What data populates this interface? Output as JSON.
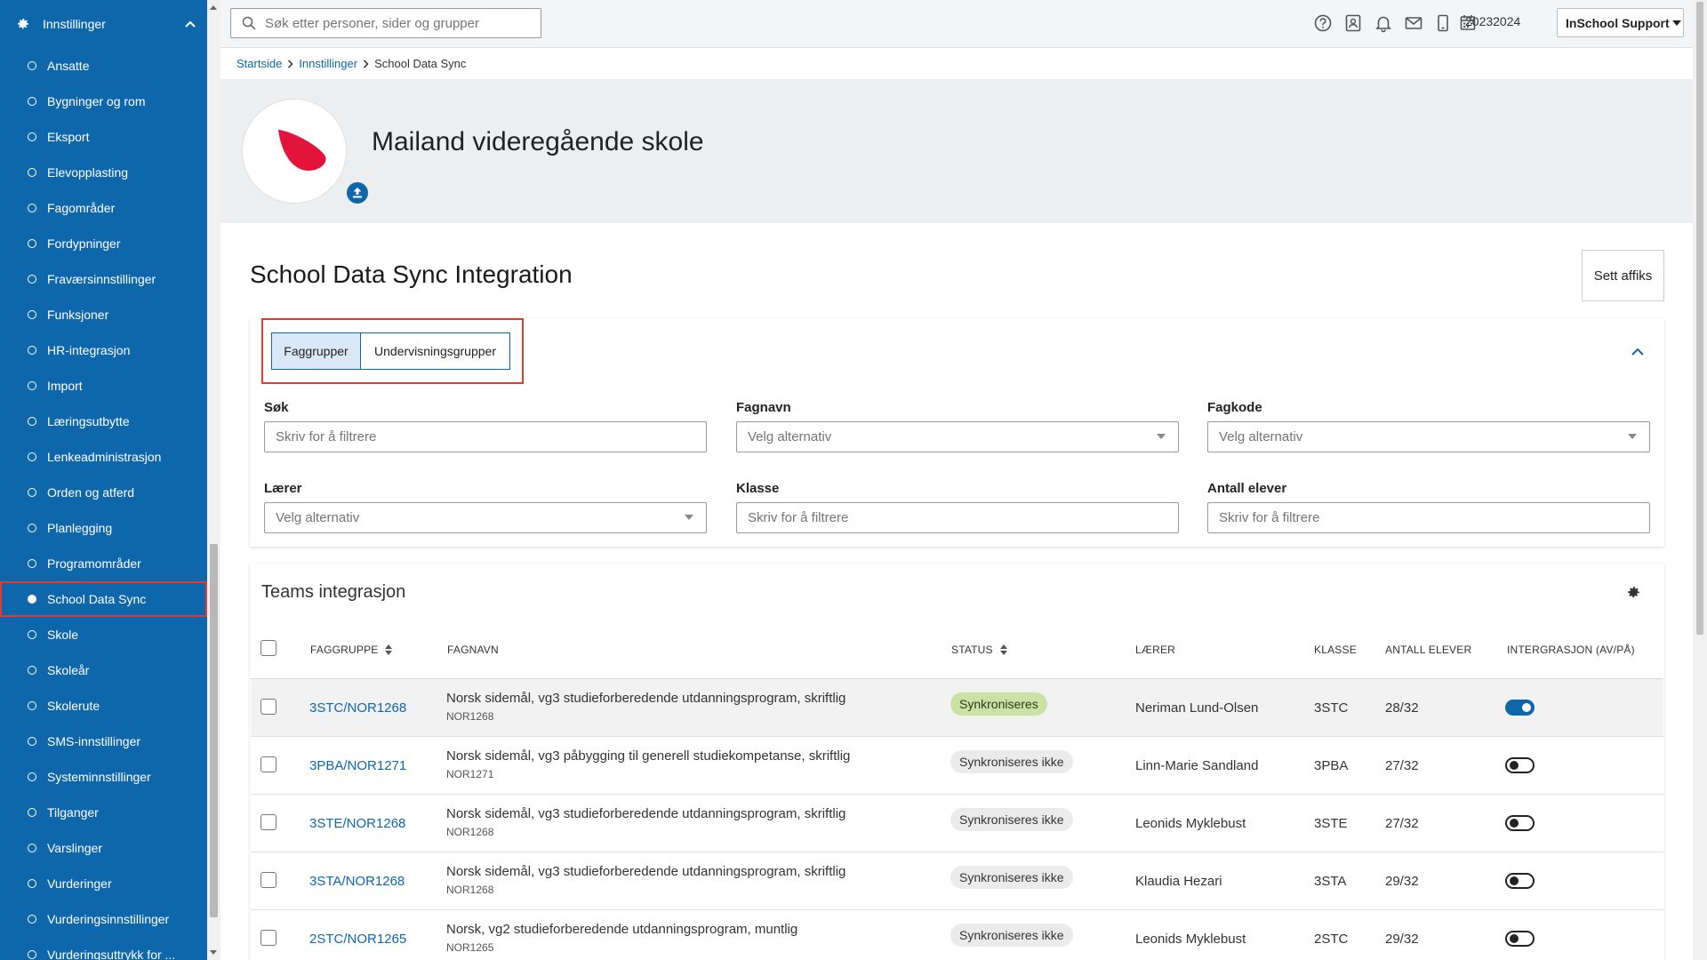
{
  "sidebar": {
    "header": "Innstillinger",
    "items": [
      {
        "label": "Ansatte"
      },
      {
        "label": "Bygninger og rom"
      },
      {
        "label": "Eksport"
      },
      {
        "label": "Elevopplasting"
      },
      {
        "label": "Fagområder"
      },
      {
        "label": "Fordypninger"
      },
      {
        "label": "Fraværsinnstillinger"
      },
      {
        "label": "Funksjoner"
      },
      {
        "label": "HR-integrasjon"
      },
      {
        "label": "Import"
      },
      {
        "label": "Læringsutbytte"
      },
      {
        "label": "Lenkeadministrasjon"
      },
      {
        "label": "Orden og atferd"
      },
      {
        "label": "Planlegging"
      },
      {
        "label": "Programområder"
      },
      {
        "label": "School Data Sync",
        "active": true
      },
      {
        "label": "Skole"
      },
      {
        "label": "Skoleår"
      },
      {
        "label": "Skolerute"
      },
      {
        "label": "SMS-innstillinger"
      },
      {
        "label": "Systeminnstillinger"
      },
      {
        "label": "Tilganger"
      },
      {
        "label": "Varslinger"
      },
      {
        "label": "Vurderinger"
      },
      {
        "label": "Vurderingsinnstillinger"
      },
      {
        "label": "Vurderingsuttrykk for ..."
      }
    ]
  },
  "topbar": {
    "search_placeholder": "Søk etter personer, sider og grupper",
    "icons": [
      "help-icon",
      "contact-card-icon",
      "bell-icon",
      "mail-icon",
      "mobile-icon",
      "calendar-icon"
    ],
    "school_year": "20232024",
    "user_menu": "InSchool Support"
  },
  "breadcrumb": {
    "home": "Startside",
    "settings": "Innstillinger",
    "current": "School Data Sync"
  },
  "header": {
    "school_name": "Mailand videregående skole",
    "logo_color": "#e2143c"
  },
  "page": {
    "title": "School Data Sync Integration",
    "affix_button": "Sett affiks"
  },
  "filters": {
    "tabs": [
      "Faggrupper",
      "Undervisningsgrupper"
    ],
    "active_tab": "Faggrupper",
    "fields": {
      "search": {
        "label": "Søk",
        "placeholder": "Skriv for å filtrere"
      },
      "subject_name": {
        "label": "Fagnavn",
        "placeholder": "Velg alternativ"
      },
      "subject_code": {
        "label": "Fagkode",
        "placeholder": "Velg alternativ"
      },
      "teacher": {
        "label": "Lærer",
        "placeholder": "Velg alternativ"
      },
      "class": {
        "label": "Klasse",
        "placeholder": "Skriv for å filtrere"
      },
      "students": {
        "label": "Antall elever",
        "placeholder": "Skriv for å filtrere"
      }
    }
  },
  "table": {
    "title": "Teams integrasjon",
    "columns": {
      "group": "FAGGRUPPE",
      "subject": "FAGNAVN",
      "status": "STATUS",
      "teacher": "LÆRER",
      "class": "KLASSE",
      "students": "ANTALL ELEVER",
      "integration": "INTERGRASJON (AV/PÅ)"
    },
    "rows": [
      {
        "group": "3STC/NOR1268",
        "subject": "Norsk sidemål, vg3 studieforberedende utdanningsprogram, skriftlig",
        "code": "NOR1268",
        "status": "Synkroniseres",
        "teacher": "Neriman Lund-Olsen",
        "class": "3STC",
        "students": "28/32",
        "enabled": true
      },
      {
        "group": "3PBA/NOR1271",
        "subject": "Norsk sidemål, vg3 påbygging til generell studiekompetanse, skriftlig",
        "code": "NOR1271",
        "status": "Synkroniseres ikke",
        "teacher": "Linn-Marie Sandland",
        "class": "3PBA",
        "students": "27/32",
        "enabled": false
      },
      {
        "group": "3STE/NOR1268",
        "subject": "Norsk sidemål, vg3 studieforberedende utdanningsprogram, skriftlig",
        "code": "NOR1268",
        "status": "Synkroniseres ikke",
        "teacher": "Leonids Myklebust",
        "class": "3STE",
        "students": "27/32",
        "enabled": false
      },
      {
        "group": "3STA/NOR1268",
        "subject": "Norsk sidemål, vg3 studieforberedende utdanningsprogram, skriftlig",
        "code": "NOR1268",
        "status": "Synkroniseres ikke",
        "teacher": "Klaudia Hezari",
        "class": "3STA",
        "students": "29/32",
        "enabled": false
      },
      {
        "group": "2STC/NOR1265",
        "subject": "Norsk, vg2 studieforberedende utdanningsprogram, muntlig",
        "code": "NOR1265",
        "status": "Synkroniseres ikke",
        "teacher": "Leonids Myklebust",
        "class": "2STC",
        "students": "29/32",
        "enabled": false
      }
    ]
  },
  "colors": {
    "sidebar": "#0e67ab",
    "accent": "#0e67ab",
    "highlight_border": "#e53935",
    "sync_badge": "#c9e2a6"
  }
}
